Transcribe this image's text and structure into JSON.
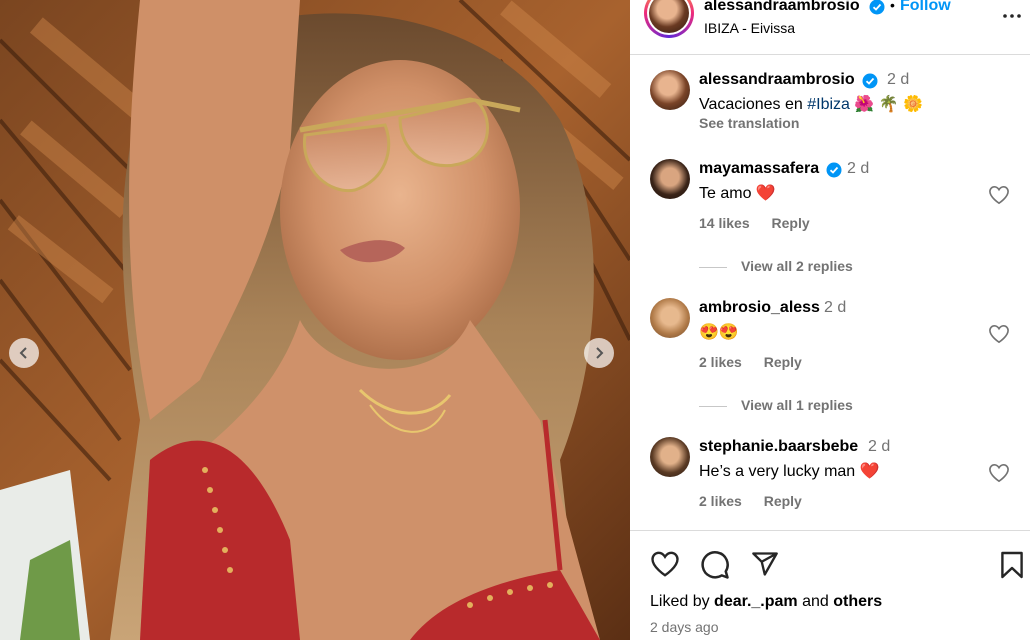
{
  "post": {
    "author": "alessandraambrosio",
    "follow_label": "Follow",
    "dot": "•",
    "location": "IBIZA - Eivissa",
    "caption_author": "alessandraambrosio",
    "caption_time": "2 d",
    "caption_text": "Vacaciones en ",
    "caption_tag": "#Ibiza",
    "caption_emojis": "🌺 🌴 🌼",
    "see_translation": "See translation"
  },
  "comments": [
    {
      "user": "mayamassafera",
      "verified": true,
      "time": "2 d",
      "text": "Te amo",
      "emoji": "❤️",
      "likes": "14 likes",
      "reply": "Reply",
      "view_replies": "View all 2 replies"
    },
    {
      "user": "ambrosio_aless",
      "verified": false,
      "time": "2 d",
      "text": "",
      "emoji": "😍😍",
      "likes": "2 likes",
      "reply": "Reply",
      "view_replies": "View all 1 replies"
    },
    {
      "user": "stephanie.baarsbebe",
      "verified": false,
      "time": "2 d",
      "text": "He’s a very lucky man",
      "emoji": "❤️",
      "likes": "2 likes",
      "reply": "Reply"
    }
  ],
  "footer": {
    "liked_by_prefix": "Liked by ",
    "liked_by_user": "dear._.pam",
    "liked_by_and": " and ",
    "liked_by_others": "others",
    "posted_ago": "2 days ago"
  },
  "icons": {
    "verified": "verified-badge-icon",
    "more": "more-options-icon",
    "like": "heart-icon",
    "comment": "comment-icon",
    "share": "share-icon",
    "save": "bookmark-icon",
    "prev": "chevron-left-icon",
    "next": "chevron-right-icon"
  },
  "colors": {
    "accent": "#0095f6",
    "heart_red": "#ed4956",
    "muted": "#737373",
    "hashtag": "#00376b"
  }
}
